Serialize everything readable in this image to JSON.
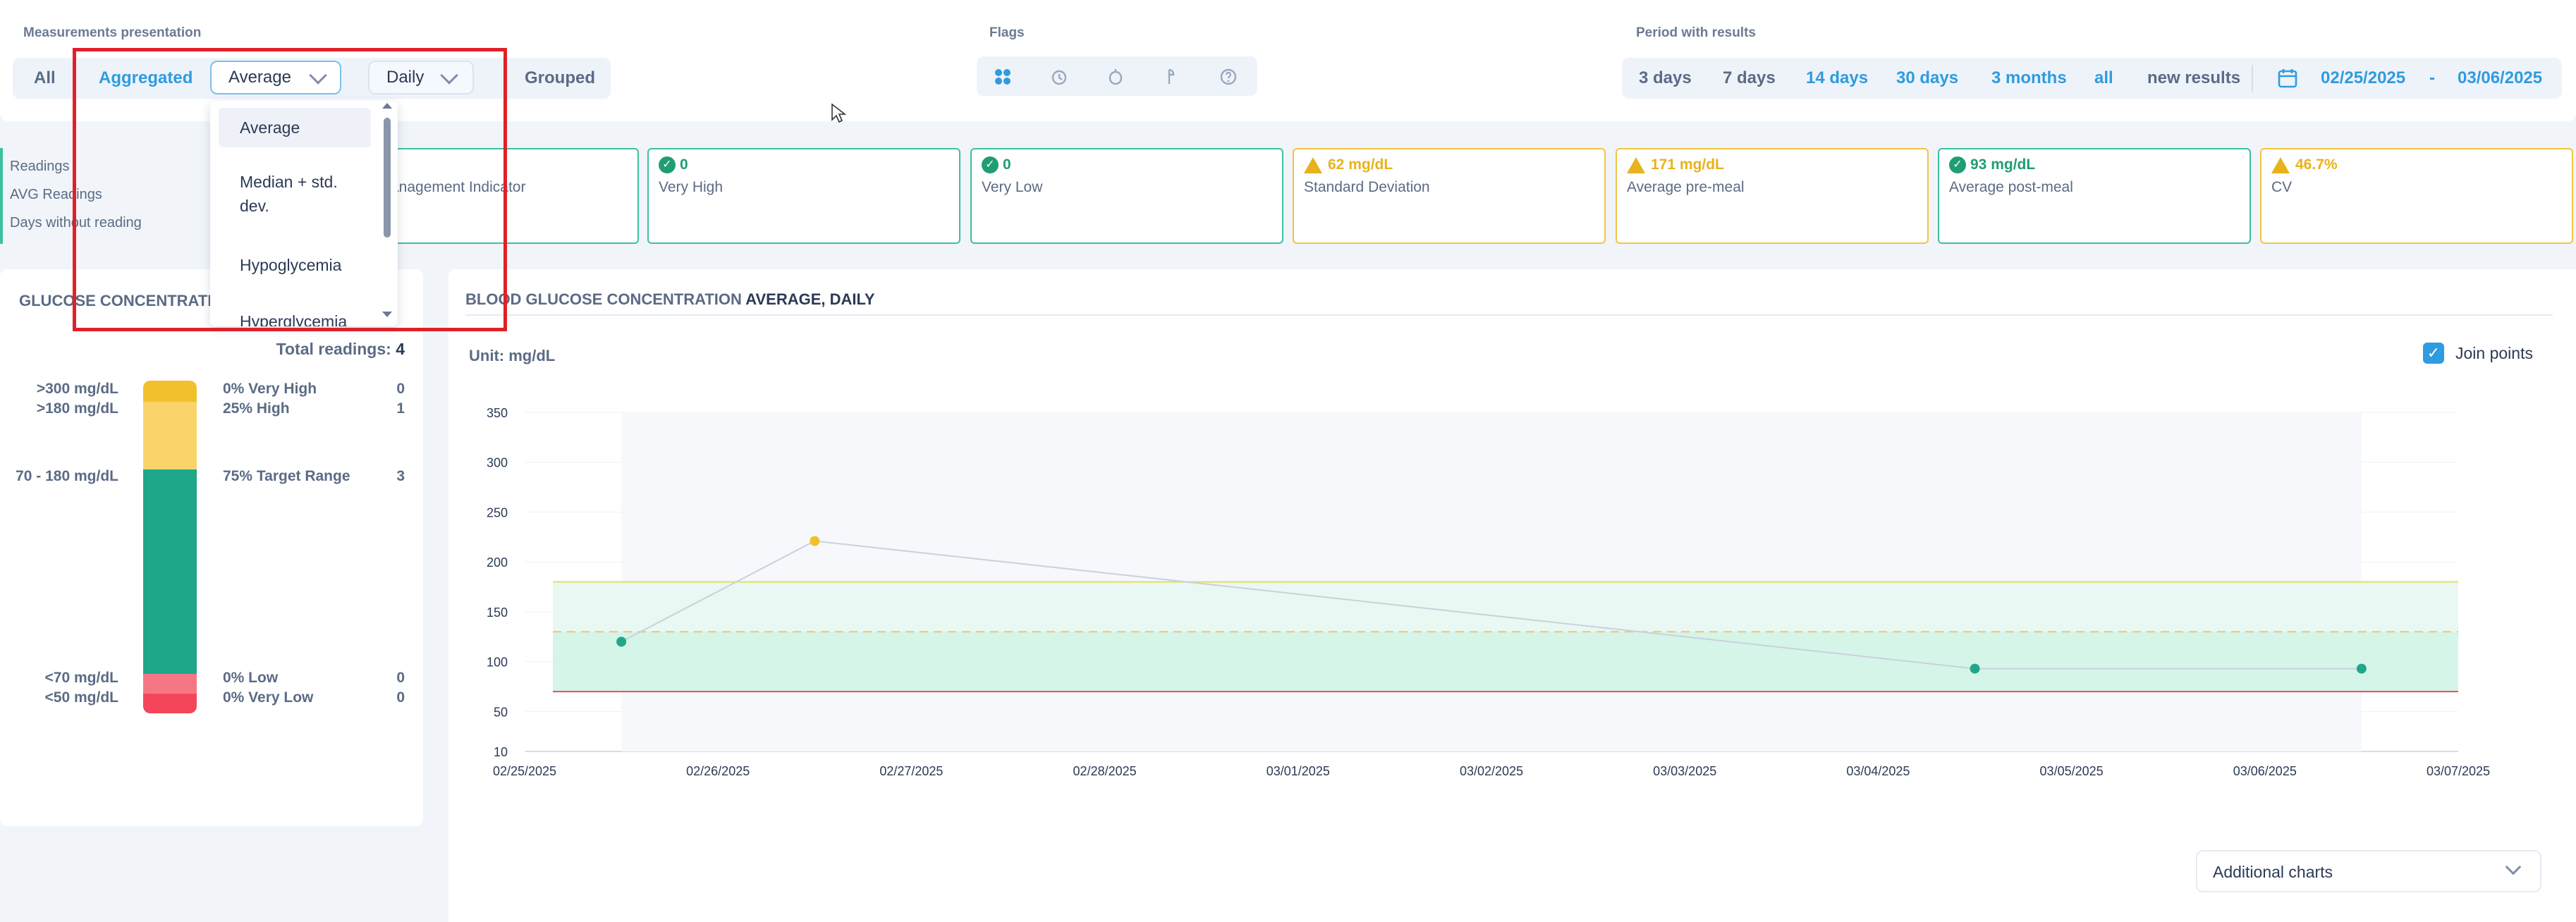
{
  "measurements": {
    "title": "Measurements presentation",
    "all": "All",
    "aggregated": "Aggregated",
    "aggregation_select": "Average",
    "interval_select": "Daily",
    "grouped": "Grouped"
  },
  "aggregation_dropdown": {
    "options": [
      "Average",
      "Median + std. dev.",
      "Hypoglycemia",
      "Hyperglycemia"
    ],
    "selected": "Average"
  },
  "flags": {
    "title": "Flags",
    "icons": [
      "all-flags-icon",
      "fasting-icon",
      "pre-meal-icon",
      "post-meal-icon",
      "unknown-icon"
    ]
  },
  "period": {
    "title": "Period with results",
    "options": [
      "3 days",
      "7 days",
      "14 days",
      "30 days",
      "3 months",
      "all",
      "new results"
    ],
    "active": [
      "14 days",
      "30 days",
      "3 months",
      "all"
    ],
    "date_from": "02/25/2025",
    "date_sep": "-",
    "date_to": "03/06/2025"
  },
  "summary": {
    "items": [
      "Readings",
      "AVG Readings",
      "Days without reading"
    ]
  },
  "cards": [
    {
      "value": "",
      "name": "anagement Indicator",
      "status": "green"
    },
    {
      "value": "0",
      "name": "Very High",
      "status": "green"
    },
    {
      "value": "0",
      "name": "Very Low",
      "status": "green"
    },
    {
      "value": "62 mg/dL",
      "name": "Standard Deviation",
      "status": "yellow"
    },
    {
      "value": "171 mg/dL",
      "name": "Average pre-meal",
      "status": "yellow"
    },
    {
      "value": "93 mg/dL",
      "name": "Average post-meal",
      "status": "green"
    },
    {
      "value": "46.7%",
      "name": "CV",
      "status": "yellow"
    }
  ],
  "distribution": {
    "title": "GLUCOSE CONCENTRATIO",
    "total_label": "Total readings:",
    "total_value": "4",
    "rows": [
      {
        "range": ">300 mg/dL",
        "label": "0% Very High",
        "count": "0"
      },
      {
        "range": ">180 mg/dL",
        "label": "25% High",
        "count": "1"
      },
      {
        "range": "70 - 180 mg/dL",
        "label": "75% Target Range",
        "count": "3"
      },
      {
        "range": "<70 mg/dL",
        "label": "0% Low",
        "count": "0"
      },
      {
        "range": "<50 mg/dL",
        "label": "0% Very Low",
        "count": "0"
      }
    ],
    "colors": {
      "very_high": "#f2c02d",
      "high": "#f8d46a",
      "target": "#1fa789",
      "low": "#f57785",
      "very_low": "#f4465a"
    }
  },
  "chart": {
    "title_prefix": "BLOOD GLUCOSE CONCENTRATION ",
    "title_bold": "AVERAGE, DAILY",
    "unit": "Unit: mg/dL",
    "join_points_label": "Join points",
    "additional_charts": "Additional charts"
  },
  "chart_data": {
    "type": "line",
    "y_ticks": [
      350,
      300,
      250,
      200,
      150,
      100,
      50,
      10
    ],
    "x_ticks": [
      "02/25/2025",
      "02/26/2025",
      "02/27/2025",
      "02/28/2025",
      "03/01/2025",
      "03/02/2025",
      "03/03/2025",
      "03/04/2025",
      "03/05/2025",
      "03/06/2025",
      "03/07/2025"
    ],
    "ylim": [
      10,
      350
    ],
    "target_range": [
      70,
      180
    ],
    "dashed_line": 130,
    "points": [
      {
        "x": "02/25/2025",
        "y": 120,
        "color": "#1fa789"
      },
      {
        "x": "02/26/2025",
        "y": 221,
        "color": "#f2c02d"
      },
      {
        "x": "03/04/2025",
        "y": 93,
        "color": "#1fa789"
      },
      {
        "x": "03/06/2025",
        "y": 93,
        "color": "#1fa789"
      }
    ]
  }
}
